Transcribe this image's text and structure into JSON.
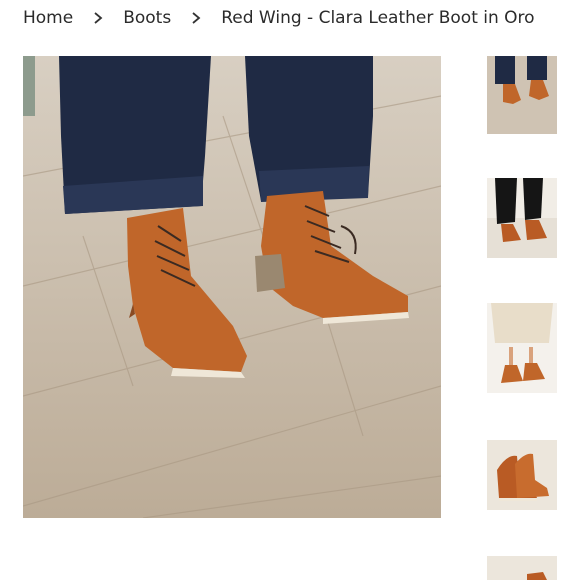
{
  "breadcrumb": {
    "items": [
      {
        "label": "Home"
      },
      {
        "label": "Boots"
      }
    ],
    "current": "Red Wing - Clara Leather Boot in Oro",
    "separator_icon": "chevron-right-icon"
  },
  "gallery": {
    "main_image": "boots-on-wood-floor-photo",
    "thumbnails": [
      "thumbnail-boots-front",
      "thumbnail-boots-side",
      "thumbnail-boots-with-skirt",
      "thumbnail-boot-pair-studio",
      "thumbnail-boot-partial"
    ]
  },
  "colors": {
    "leather": "#c0662a",
    "denim": "#1f2a44",
    "floor": "#c9b9a4"
  }
}
